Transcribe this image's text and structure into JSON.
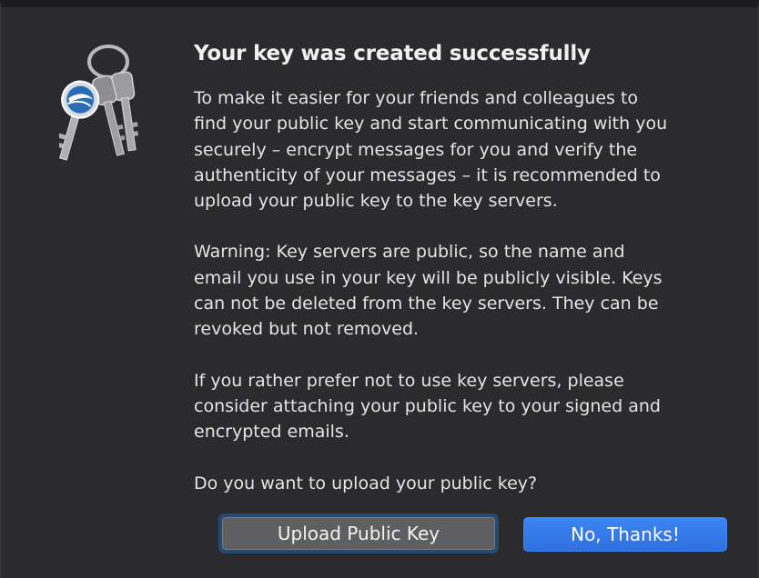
{
  "dialog": {
    "title": "Your key was created successfully",
    "paragraph_1": "To make it easier for your friends and colleagues to\nfind your public key and start communicating with you\nsecurely – encrypt messages for you and verify the\nauthenticity of your messages – it is recommended to\nupload your public key to the key servers.",
    "paragraph_2": "Warning: Key servers are public, so the name and\nemail you use in your key will be publicly visible. Keys\ncan not be deleted from the key servers. They can be\nrevoked but not removed.",
    "paragraph_3": "If you rather prefer not to use key servers, please\nconsider attaching your public key to your signed and\nencrypted emails.",
    "question": "Do you want to upload your public key?",
    "app_icon": "keychain-icon"
  },
  "buttons": {
    "upload_label": "Upload Public Key",
    "decline_label": "No, Thanks!"
  },
  "colors": {
    "background": "#2b2b2d",
    "primary_button": "#2f6fe0",
    "focus_ring": "#244a72",
    "secondary_button": "#5f5f61"
  }
}
